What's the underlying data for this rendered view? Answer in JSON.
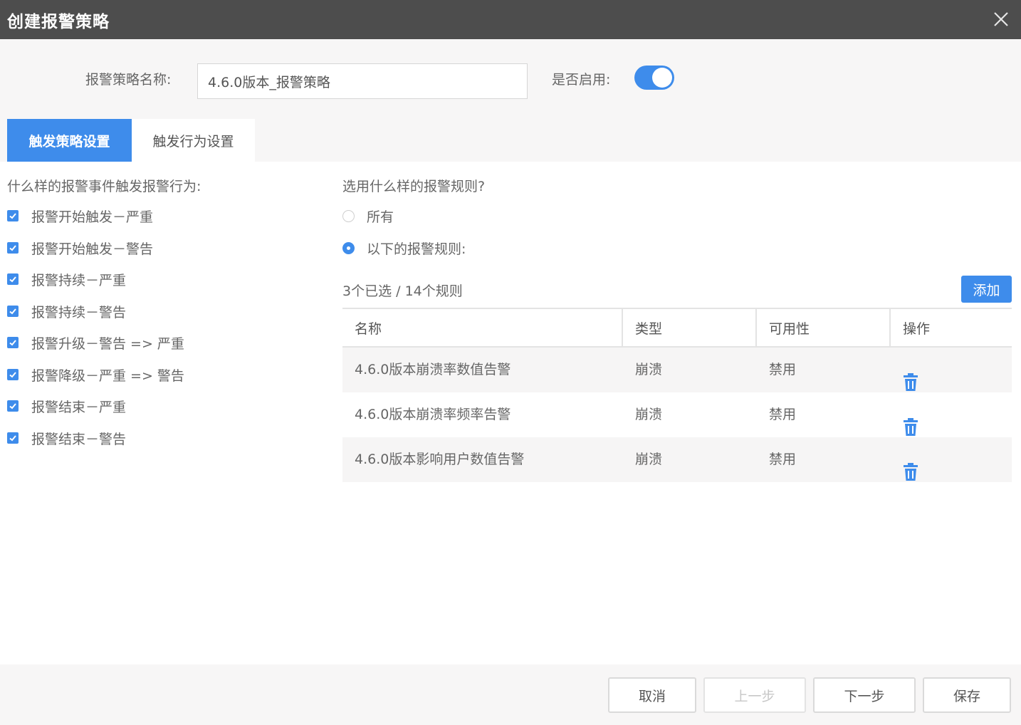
{
  "dialog": {
    "title": "创建报警策略"
  },
  "form": {
    "name_label": "报警策略名称:",
    "name_value": "4.6.0版本_报警策略",
    "enable_label": "是否启用:",
    "enabled": true
  },
  "tabs": [
    {
      "label": "触发策略设置",
      "active": true
    },
    {
      "label": "触发行为设置",
      "active": false
    }
  ],
  "events": {
    "question": "什么样的报警事件触发报警行为:",
    "items": [
      {
        "label": "报警开始触发－严重",
        "checked": true
      },
      {
        "label": "报警开始触发－警告",
        "checked": true
      },
      {
        "label": "报警持续－严重",
        "checked": true
      },
      {
        "label": "报警持续－警告",
        "checked": true
      },
      {
        "label": "报警升级－警告 => 严重",
        "checked": true
      },
      {
        "label": "报警降级－严重 => 警告",
        "checked": true
      },
      {
        "label": "报警结束－严重",
        "checked": true
      },
      {
        "label": "报警结束－警告",
        "checked": true
      }
    ]
  },
  "rules": {
    "question": "选用什么样的报警规则?",
    "options": [
      {
        "label": "所有",
        "selected": false
      },
      {
        "label": "以下的报警规则:",
        "selected": true
      }
    ],
    "count_text": "3个已选 / 14个规则",
    "add_label": "添加",
    "columns": [
      "名称",
      "类型",
      "可用性",
      "操作"
    ],
    "rows": [
      {
        "name": "4.6.0版本崩溃率数值告警",
        "type": "崩溃",
        "availability": "禁用",
        "action_icon": "trash-icon"
      },
      {
        "name": "4.6.0版本崩溃率频率告警",
        "type": "崩溃",
        "availability": "禁用",
        "action_icon": "trash-icon"
      },
      {
        "name": "4.6.0版本影响用户数值告警",
        "type": "崩溃",
        "availability": "禁用",
        "action_icon": "trash-icon"
      }
    ]
  },
  "footer": {
    "cancel": "取消",
    "prev": "上一步",
    "prev_disabled": true,
    "next": "下一步",
    "save": "保存"
  },
  "colors": {
    "accent": "#3e8ceb",
    "titlebar": "#4d4d4d",
    "band": "#f7f6f6"
  }
}
